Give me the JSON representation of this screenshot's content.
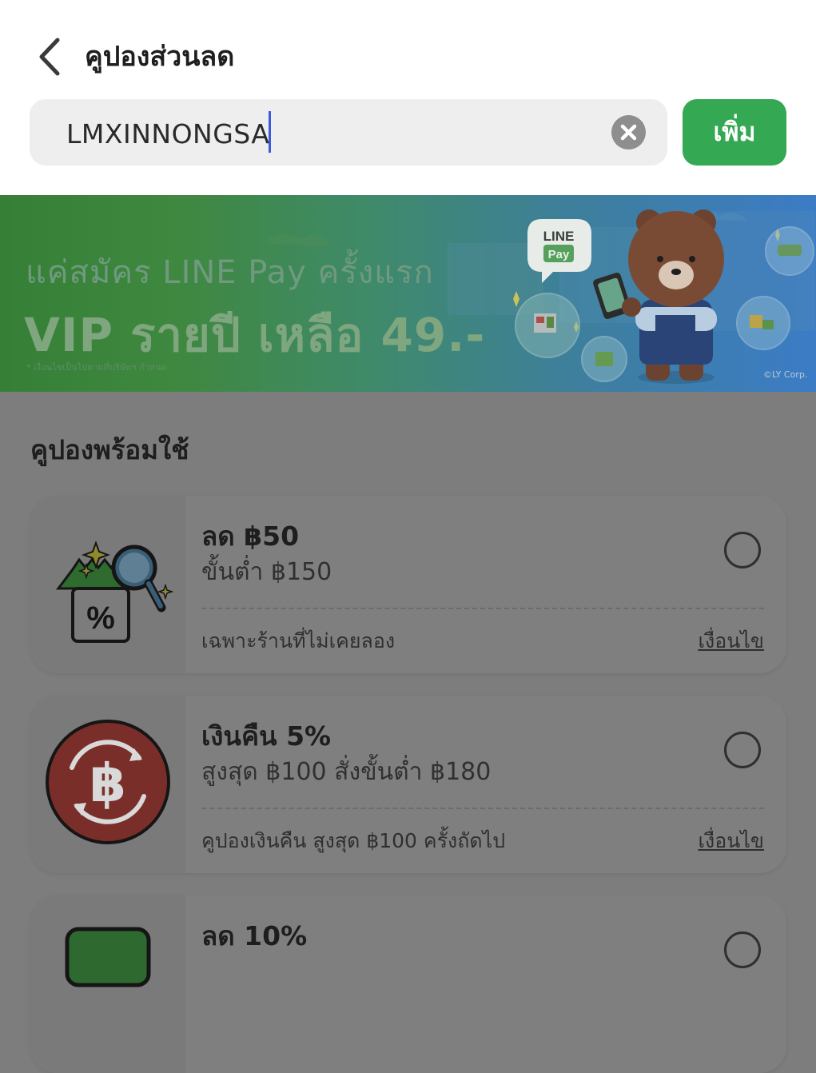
{
  "header": {
    "title": "คูปองส่วนลด",
    "back_icon": "chevron-left-icon"
  },
  "search": {
    "value": "LMXINNONGSA",
    "clear_icon": "clear-icon",
    "add_label": "เพิ่ม",
    "add_color": "#34a853"
  },
  "banner": {
    "line1": "แค่สมัคร LINE Pay ครั้งแรก",
    "line2": "VIP รายปี เหลือ 49.-",
    "note": "* เงื่อนไขเป็นไปตามที่บริษัทฯ กำหนด",
    "logo_line": "LINE",
    "logo_pay": "Pay",
    "copyright": "©LY Corp."
  },
  "section": {
    "title": "คูปองพร้อมใช้"
  },
  "coupons": [
    {
      "title": "ลด ฿50",
      "subtitle": "ขั้นต่ำ ฿150",
      "note": "เฉพาะร้านที่ไม่เคยลอง",
      "condition_link": "เงื่อนไข",
      "icon": "coupon-search-icon"
    },
    {
      "title": "เงินคืน 5%",
      "subtitle": "สูงสุด ฿100 สั่งขั้นต่ำ ฿180",
      "note": "คูปองเงินคืน สูงสุด ฿100 ครั้งถัดไป",
      "condition_link": "เงื่อนไข",
      "icon": "baht-cashback-icon"
    },
    {
      "title": "ลด 10%",
      "icon": "green-ticket-icon"
    }
  ]
}
